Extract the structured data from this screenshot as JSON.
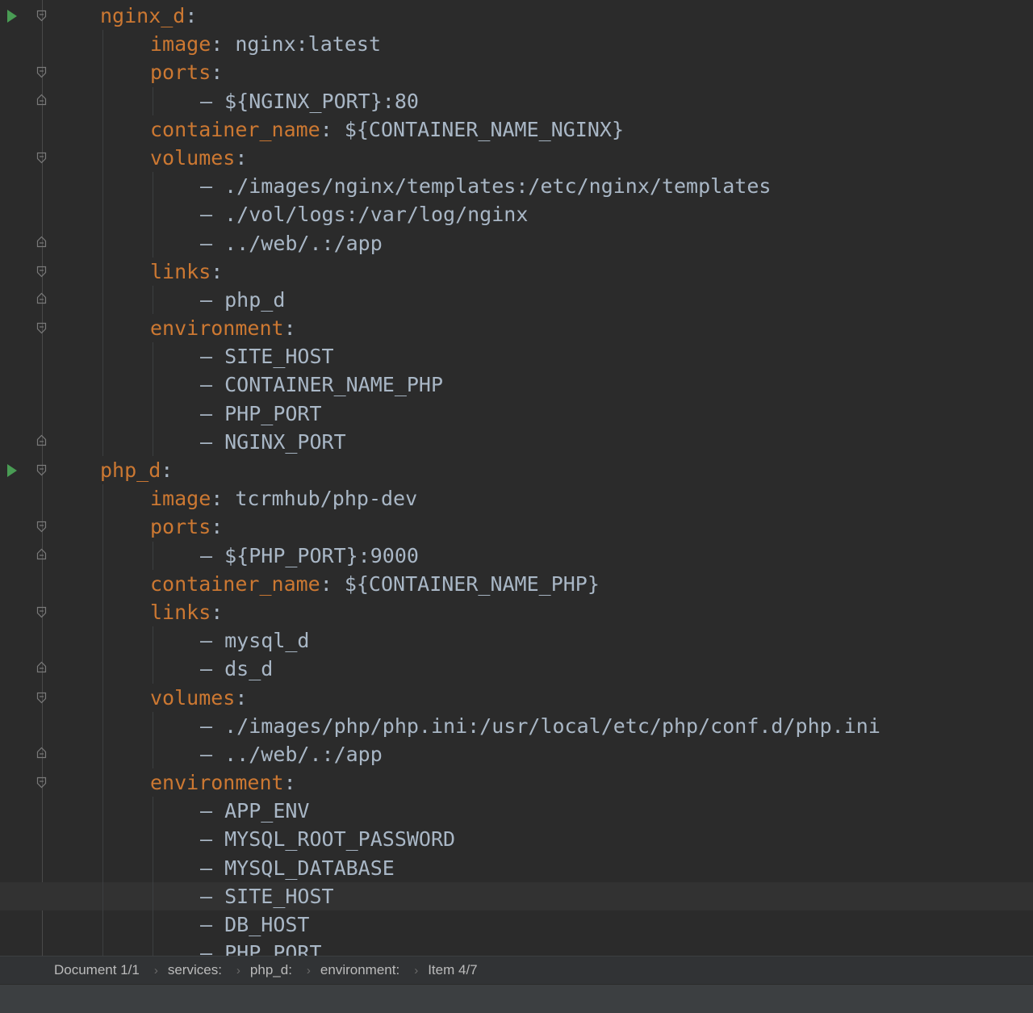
{
  "editor": {
    "lines": [
      {
        "key": "nginx_d",
        "colon": ":",
        "value": "",
        "run": true,
        "fold": "open",
        "indent": 0,
        "dash": false
      },
      {
        "key": "image",
        "colon": ":",
        "value": " nginx:latest",
        "run": false,
        "fold": "",
        "indent": 1,
        "dash": false
      },
      {
        "key": "ports",
        "colon": ":",
        "value": "",
        "run": false,
        "fold": "open",
        "indent": 1,
        "dash": false
      },
      {
        "key": "",
        "colon": "",
        "value": "${NGINX_PORT}:80",
        "run": false,
        "fold": "close",
        "indent": 2,
        "dash": true
      },
      {
        "key": "container_name",
        "colon": ":",
        "value": " ${CONTAINER_NAME_NGINX}",
        "run": false,
        "fold": "",
        "indent": 1,
        "dash": false
      },
      {
        "key": "volumes",
        "colon": ":",
        "value": "",
        "run": false,
        "fold": "open",
        "indent": 1,
        "dash": false
      },
      {
        "key": "",
        "colon": "",
        "value": "./images/nginx/templates:/etc/nginx/templates",
        "run": false,
        "fold": "",
        "indent": 2,
        "dash": true
      },
      {
        "key": "",
        "colon": "",
        "value": "./vol/logs:/var/log/nginx",
        "run": false,
        "fold": "",
        "indent": 2,
        "dash": true
      },
      {
        "key": "",
        "colon": "",
        "value": "../web/.:/app",
        "run": false,
        "fold": "close",
        "indent": 2,
        "dash": true
      },
      {
        "key": "links",
        "colon": ":",
        "value": "",
        "run": false,
        "fold": "open",
        "indent": 1,
        "dash": false
      },
      {
        "key": "",
        "colon": "",
        "value": "php_d",
        "run": false,
        "fold": "close",
        "indent": 2,
        "dash": true
      },
      {
        "key": "environment",
        "colon": ":",
        "value": "",
        "run": false,
        "fold": "open",
        "indent": 1,
        "dash": false
      },
      {
        "key": "",
        "colon": "",
        "value": "SITE_HOST",
        "run": false,
        "fold": "",
        "indent": 2,
        "dash": true
      },
      {
        "key": "",
        "colon": "",
        "value": "CONTAINER_NAME_PHP",
        "run": false,
        "fold": "",
        "indent": 2,
        "dash": true
      },
      {
        "key": "",
        "colon": "",
        "value": "PHP_PORT",
        "run": false,
        "fold": "",
        "indent": 2,
        "dash": true
      },
      {
        "key": "",
        "colon": "",
        "value": "NGINX_PORT",
        "run": false,
        "fold": "close",
        "indent": 2,
        "dash": true
      },
      {
        "key": "php_d",
        "colon": ":",
        "value": "",
        "run": true,
        "fold": "open",
        "indent": 0,
        "dash": false
      },
      {
        "key": "image",
        "colon": ":",
        "value": " tcrmhub/php-dev",
        "run": false,
        "fold": "",
        "indent": 1,
        "dash": false
      },
      {
        "key": "ports",
        "colon": ":",
        "value": "",
        "run": false,
        "fold": "open",
        "indent": 1,
        "dash": false
      },
      {
        "key": "",
        "colon": "",
        "value": "${PHP_PORT}:9000",
        "run": false,
        "fold": "close",
        "indent": 2,
        "dash": true
      },
      {
        "key": "container_name",
        "colon": ":",
        "value": " ${CONTAINER_NAME_PHP}",
        "run": false,
        "fold": "",
        "indent": 1,
        "dash": false
      },
      {
        "key": "links",
        "colon": ":",
        "value": "",
        "run": false,
        "fold": "open",
        "indent": 1,
        "dash": false
      },
      {
        "key": "",
        "colon": "",
        "value": "mysql_d",
        "run": false,
        "fold": "",
        "indent": 2,
        "dash": true
      },
      {
        "key": "",
        "colon": "",
        "value": "ds_d",
        "run": false,
        "fold": "close",
        "indent": 2,
        "dash": true
      },
      {
        "key": "volumes",
        "colon": ":",
        "value": "",
        "run": false,
        "fold": "open",
        "indent": 1,
        "dash": false
      },
      {
        "key": "",
        "colon": "",
        "value": "./images/php/php.ini:/usr/local/etc/php/conf.d/php.ini",
        "run": false,
        "fold": "",
        "indent": 2,
        "dash": true
      },
      {
        "key": "",
        "colon": "",
        "value": "../web/.:/app",
        "run": false,
        "fold": "close",
        "indent": 2,
        "dash": true
      },
      {
        "key": "environment",
        "colon": ":",
        "value": "",
        "run": false,
        "fold": "open",
        "indent": 1,
        "dash": false
      },
      {
        "key": "",
        "colon": "",
        "value": "APP_ENV",
        "run": false,
        "fold": "",
        "indent": 2,
        "dash": true
      },
      {
        "key": "",
        "colon": "",
        "value": "MYSQL_ROOT_PASSWORD",
        "run": false,
        "fold": "",
        "indent": 2,
        "dash": true
      },
      {
        "key": "",
        "colon": "",
        "value": "MYSQL_DATABASE",
        "run": false,
        "fold": "",
        "indent": 2,
        "dash": true
      },
      {
        "key": "",
        "colon": "",
        "value": "SITE_HOST",
        "run": false,
        "fold": "",
        "indent": 2,
        "dash": true,
        "current": true
      },
      {
        "key": "",
        "colon": "",
        "value": "DB_HOST",
        "run": false,
        "fold": "",
        "indent": 2,
        "dash": true
      },
      {
        "key": "",
        "colon": "",
        "value": "PHP_PORT",
        "run": false,
        "fold": "",
        "indent": 2,
        "dash": true
      }
    ]
  },
  "breadcrumbs": {
    "items": [
      "Document 1/1",
      "services:",
      "php_d:",
      "environment:",
      "Item 4/7"
    ],
    "separator": "›"
  },
  "colors": {
    "background": "#2b2b2b",
    "key": "#cc7832",
    "text": "#a9b7c6",
    "run_icon": "#499c54",
    "current_line": "#323232"
  }
}
